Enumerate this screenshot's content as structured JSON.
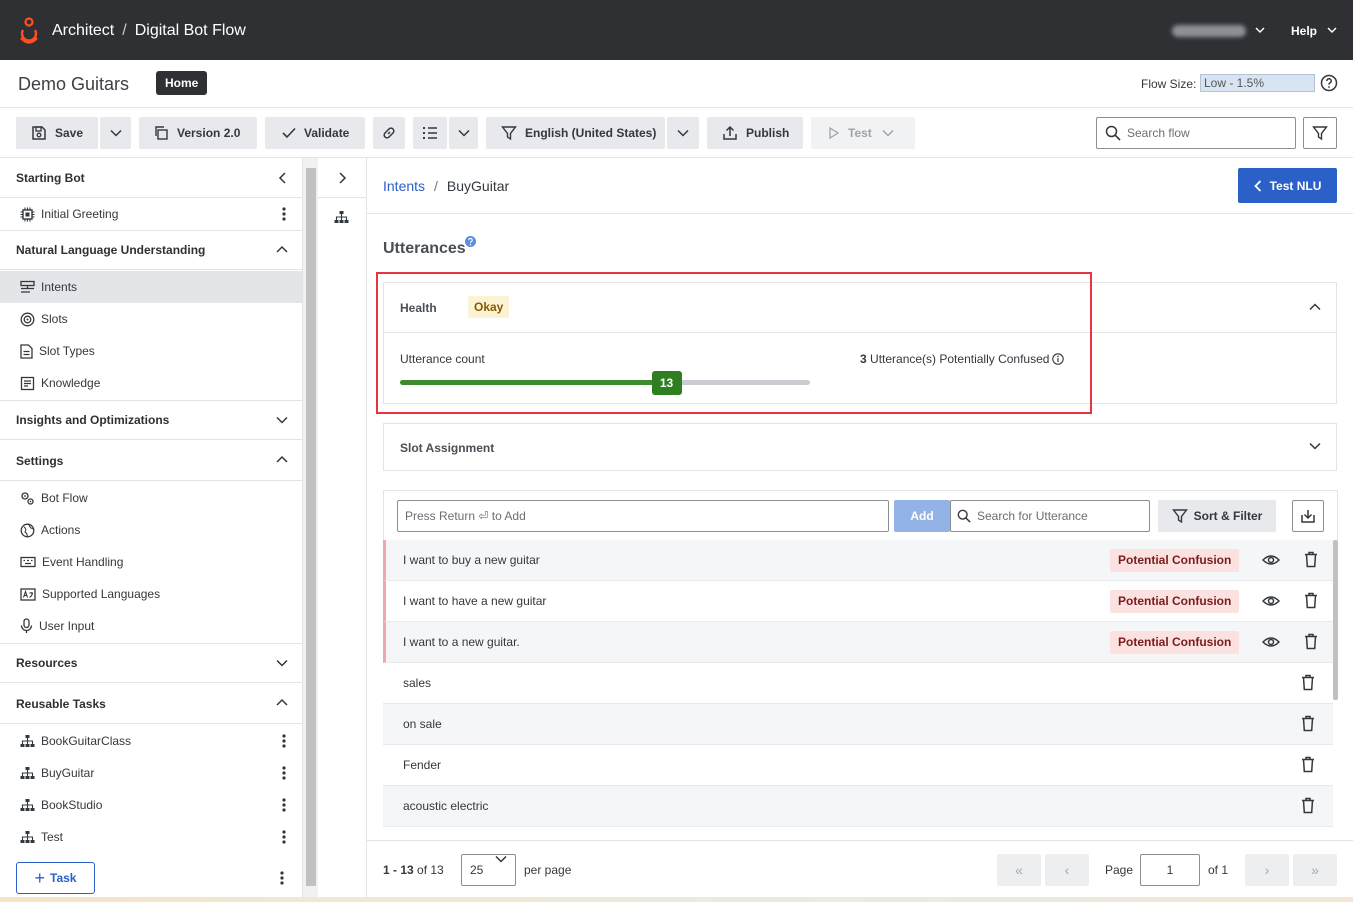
{
  "topbar": {
    "app": "Architect",
    "separator": "/",
    "page": "Digital Bot Flow",
    "help": "Help"
  },
  "header": {
    "flow_name": "Demo Guitars",
    "home_badge": "Home",
    "flow_size_label": "Flow Size:",
    "flow_size_value": "Low - 1.5%"
  },
  "toolbar": {
    "save": "Save",
    "version": "Version 2.0",
    "validate": "Validate",
    "language": "English (United States)",
    "publish": "Publish",
    "test": "Test",
    "search_placeholder": "Search flow"
  },
  "sidebar": {
    "starting_bot": {
      "title": "Starting Bot",
      "items": [
        {
          "label": "Initial Greeting"
        }
      ]
    },
    "nlu": {
      "title": "Natural Language Understanding",
      "items": [
        {
          "label": "Intents"
        },
        {
          "label": "Slots"
        },
        {
          "label": "Slot Types"
        },
        {
          "label": "Knowledge"
        }
      ]
    },
    "insights": {
      "title": "Insights and Optimizations"
    },
    "settings": {
      "title": "Settings",
      "items": [
        {
          "label": "Bot Flow"
        },
        {
          "label": "Actions"
        },
        {
          "label": "Event Handling"
        },
        {
          "label": "Supported Languages"
        },
        {
          "label": "User Input"
        }
      ]
    },
    "resources": {
      "title": "Resources"
    },
    "reusable": {
      "title": "Reusable Tasks",
      "items": [
        {
          "label": "BookGuitarClass"
        },
        {
          "label": "BuyGuitar"
        },
        {
          "label": "BookStudio"
        },
        {
          "label": "Test"
        }
      ]
    },
    "task_button": "Task"
  },
  "main": {
    "breadcrumb": {
      "parent": "Intents",
      "separator": "/",
      "current": "BuyGuitar"
    },
    "test_nlu": "Test NLU",
    "title": "Utterances",
    "health": {
      "label": "Health",
      "status": "Okay",
      "count_label": "Utterance count",
      "count_value": "13",
      "count_fill": 0.65,
      "confused_count": "3",
      "confused_text": "Utterance(s) Potentially Confused"
    },
    "slot_assignment": "Slot Assignment",
    "add_placeholder": "Press Return ⏎ to Add",
    "add_button": "Add",
    "search_placeholder": "Search for Utterance",
    "sort_filter": "Sort & Filter",
    "rows": [
      {
        "text": "I want to buy a new guitar",
        "badge": "Potential Confusion"
      },
      {
        "text": "I want to have a new guitar",
        "badge": "Potential Confusion"
      },
      {
        "text": "I want to a new guitar.",
        "badge": "Potential Confusion"
      },
      {
        "text": "sales"
      },
      {
        "text": "on sale"
      },
      {
        "text": "Fender"
      },
      {
        "text": "acoustic electric"
      }
    ],
    "pager": {
      "range": "1 - 13",
      "of_total": "of 13",
      "per_page_value": "25",
      "per_page_label": "per page",
      "page_label": "Page",
      "page_value": "1",
      "of_pages": "of 1",
      "first": "«",
      "prev": "‹",
      "next": "›",
      "last": "»"
    }
  },
  "colors": {
    "topbar": "#2e3033",
    "primary": "#2a60c8",
    "success": "#2f7f22",
    "highlight": "#e5363f",
    "confusion_bg": "#fbe2e1"
  }
}
